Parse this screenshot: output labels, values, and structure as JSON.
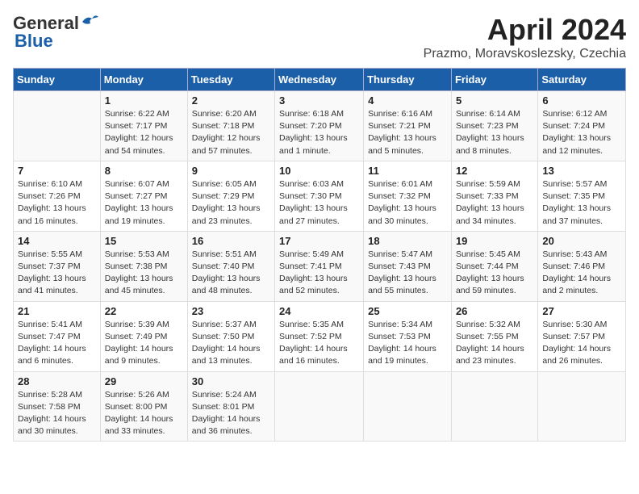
{
  "header": {
    "logo_general": "General",
    "logo_blue": "Blue",
    "month_title": "April 2024",
    "location": "Prazmo, Moravskoslezsky, Czechia"
  },
  "columns": [
    "Sunday",
    "Monday",
    "Tuesday",
    "Wednesday",
    "Thursday",
    "Friday",
    "Saturday"
  ],
  "weeks": [
    [
      {
        "day": "",
        "info": ""
      },
      {
        "day": "1",
        "info": "Sunrise: 6:22 AM\nSunset: 7:17 PM\nDaylight: 12 hours\nand 54 minutes."
      },
      {
        "day": "2",
        "info": "Sunrise: 6:20 AM\nSunset: 7:18 PM\nDaylight: 12 hours\nand 57 minutes."
      },
      {
        "day": "3",
        "info": "Sunrise: 6:18 AM\nSunset: 7:20 PM\nDaylight: 13 hours\nand 1 minute."
      },
      {
        "day": "4",
        "info": "Sunrise: 6:16 AM\nSunset: 7:21 PM\nDaylight: 13 hours\nand 5 minutes."
      },
      {
        "day": "5",
        "info": "Sunrise: 6:14 AM\nSunset: 7:23 PM\nDaylight: 13 hours\nand 8 minutes."
      },
      {
        "day": "6",
        "info": "Sunrise: 6:12 AM\nSunset: 7:24 PM\nDaylight: 13 hours\nand 12 minutes."
      }
    ],
    [
      {
        "day": "7",
        "info": "Sunrise: 6:10 AM\nSunset: 7:26 PM\nDaylight: 13 hours\nand 16 minutes."
      },
      {
        "day": "8",
        "info": "Sunrise: 6:07 AM\nSunset: 7:27 PM\nDaylight: 13 hours\nand 19 minutes."
      },
      {
        "day": "9",
        "info": "Sunrise: 6:05 AM\nSunset: 7:29 PM\nDaylight: 13 hours\nand 23 minutes."
      },
      {
        "day": "10",
        "info": "Sunrise: 6:03 AM\nSunset: 7:30 PM\nDaylight: 13 hours\nand 27 minutes."
      },
      {
        "day": "11",
        "info": "Sunrise: 6:01 AM\nSunset: 7:32 PM\nDaylight: 13 hours\nand 30 minutes."
      },
      {
        "day": "12",
        "info": "Sunrise: 5:59 AM\nSunset: 7:33 PM\nDaylight: 13 hours\nand 34 minutes."
      },
      {
        "day": "13",
        "info": "Sunrise: 5:57 AM\nSunset: 7:35 PM\nDaylight: 13 hours\nand 37 minutes."
      }
    ],
    [
      {
        "day": "14",
        "info": "Sunrise: 5:55 AM\nSunset: 7:37 PM\nDaylight: 13 hours\nand 41 minutes."
      },
      {
        "day": "15",
        "info": "Sunrise: 5:53 AM\nSunset: 7:38 PM\nDaylight: 13 hours\nand 45 minutes."
      },
      {
        "day": "16",
        "info": "Sunrise: 5:51 AM\nSunset: 7:40 PM\nDaylight: 13 hours\nand 48 minutes."
      },
      {
        "day": "17",
        "info": "Sunrise: 5:49 AM\nSunset: 7:41 PM\nDaylight: 13 hours\nand 52 minutes."
      },
      {
        "day": "18",
        "info": "Sunrise: 5:47 AM\nSunset: 7:43 PM\nDaylight: 13 hours\nand 55 minutes."
      },
      {
        "day": "19",
        "info": "Sunrise: 5:45 AM\nSunset: 7:44 PM\nDaylight: 13 hours\nand 59 minutes."
      },
      {
        "day": "20",
        "info": "Sunrise: 5:43 AM\nSunset: 7:46 PM\nDaylight: 14 hours\nand 2 minutes."
      }
    ],
    [
      {
        "day": "21",
        "info": "Sunrise: 5:41 AM\nSunset: 7:47 PM\nDaylight: 14 hours\nand 6 minutes."
      },
      {
        "day": "22",
        "info": "Sunrise: 5:39 AM\nSunset: 7:49 PM\nDaylight: 14 hours\nand 9 minutes."
      },
      {
        "day": "23",
        "info": "Sunrise: 5:37 AM\nSunset: 7:50 PM\nDaylight: 14 hours\nand 13 minutes."
      },
      {
        "day": "24",
        "info": "Sunrise: 5:35 AM\nSunset: 7:52 PM\nDaylight: 14 hours\nand 16 minutes."
      },
      {
        "day": "25",
        "info": "Sunrise: 5:34 AM\nSunset: 7:53 PM\nDaylight: 14 hours\nand 19 minutes."
      },
      {
        "day": "26",
        "info": "Sunrise: 5:32 AM\nSunset: 7:55 PM\nDaylight: 14 hours\nand 23 minutes."
      },
      {
        "day": "27",
        "info": "Sunrise: 5:30 AM\nSunset: 7:57 PM\nDaylight: 14 hours\nand 26 minutes."
      }
    ],
    [
      {
        "day": "28",
        "info": "Sunrise: 5:28 AM\nSunset: 7:58 PM\nDaylight: 14 hours\nand 30 minutes."
      },
      {
        "day": "29",
        "info": "Sunrise: 5:26 AM\nSunset: 8:00 PM\nDaylight: 14 hours\nand 33 minutes."
      },
      {
        "day": "30",
        "info": "Sunrise: 5:24 AM\nSunset: 8:01 PM\nDaylight: 14 hours\nand 36 minutes."
      },
      {
        "day": "",
        "info": ""
      },
      {
        "day": "",
        "info": ""
      },
      {
        "day": "",
        "info": ""
      },
      {
        "day": "",
        "info": ""
      }
    ]
  ]
}
